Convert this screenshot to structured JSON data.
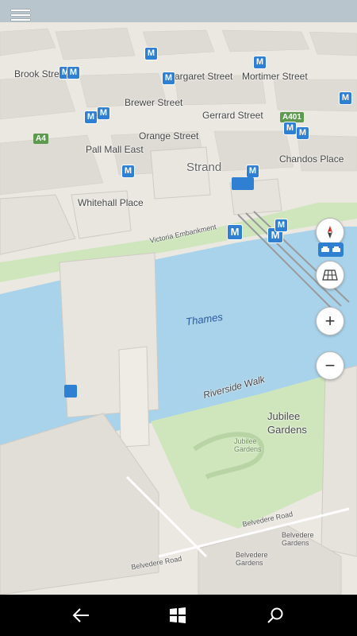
{
  "map": {
    "streets": {
      "brook": "Brook Street",
      "margaret": "Margaret Street",
      "mortimer": "Mortimer Street",
      "brewer": "Brewer Street",
      "gerrard": "Gerrard Street",
      "orange": "Orange Street",
      "pall_mall": "Pall Mall East",
      "chandos": "Chandos Place",
      "strand": "Strand",
      "whitehall": "Whitehall Place",
      "victoria_embankment": "Victoria Embankment",
      "riverside_walk": "Riverside Walk",
      "belvedere_road": "Belvedere Road",
      "belvedere_road_2": "Belvedere Road"
    },
    "road_shields": {
      "a401": "A401",
      "a4": "A4"
    },
    "water": {
      "thames": "Thames"
    },
    "parks": {
      "jubilee": "Jubilee Gardens",
      "jubilee_small": "Jubilee Gardens"
    },
    "places": {
      "belvedere_gardens": "Belvedere Gardens",
      "belvedere_gardens_2": "Belvedere Gardens"
    },
    "metro_glyph": "M"
  },
  "controls": {
    "zoom_in": "+",
    "zoom_out": "−"
  },
  "colors": {
    "water": "#a9d3ea",
    "park": "#cfe6bd",
    "buildings": "#e7e4de",
    "metro": "#2f7fd3",
    "road_shield": "#5d9a4f",
    "taskbar": "#000000"
  }
}
